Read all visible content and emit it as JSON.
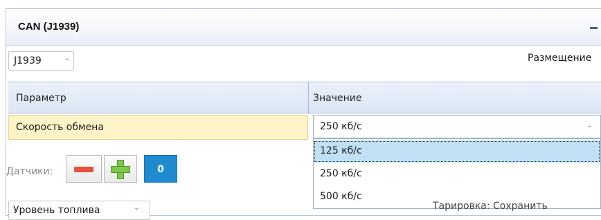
{
  "panel": {
    "title": "CAN (J1939)"
  },
  "protocol_select": {
    "value": "J1939"
  },
  "placement_label": "Размещение",
  "grid": {
    "columns": [
      "Параметр",
      "Значение"
    ],
    "row": {
      "param": "Скорость обмена",
      "value": "250 кб/с"
    }
  },
  "dropdown": {
    "options": [
      "125 кб/с",
      "250 кб/с",
      "500 кб/с"
    ],
    "highlighted": "125 кб/с"
  },
  "sensors": {
    "label": "Датчики:",
    "count": "0"
  },
  "bottom": {
    "level_select": "Уровень топлива",
    "right_text": "Тарировка: Сохранить"
  },
  "icons": {
    "minus": "minus-icon",
    "plus": "plus-icon",
    "collapse": "collapse-icon",
    "chevron": "chevron-down-icon"
  },
  "colors": {
    "accent": "#1e8bd0",
    "selected_row": "#fff4c7",
    "option_highlight": "#bfe0f5"
  }
}
